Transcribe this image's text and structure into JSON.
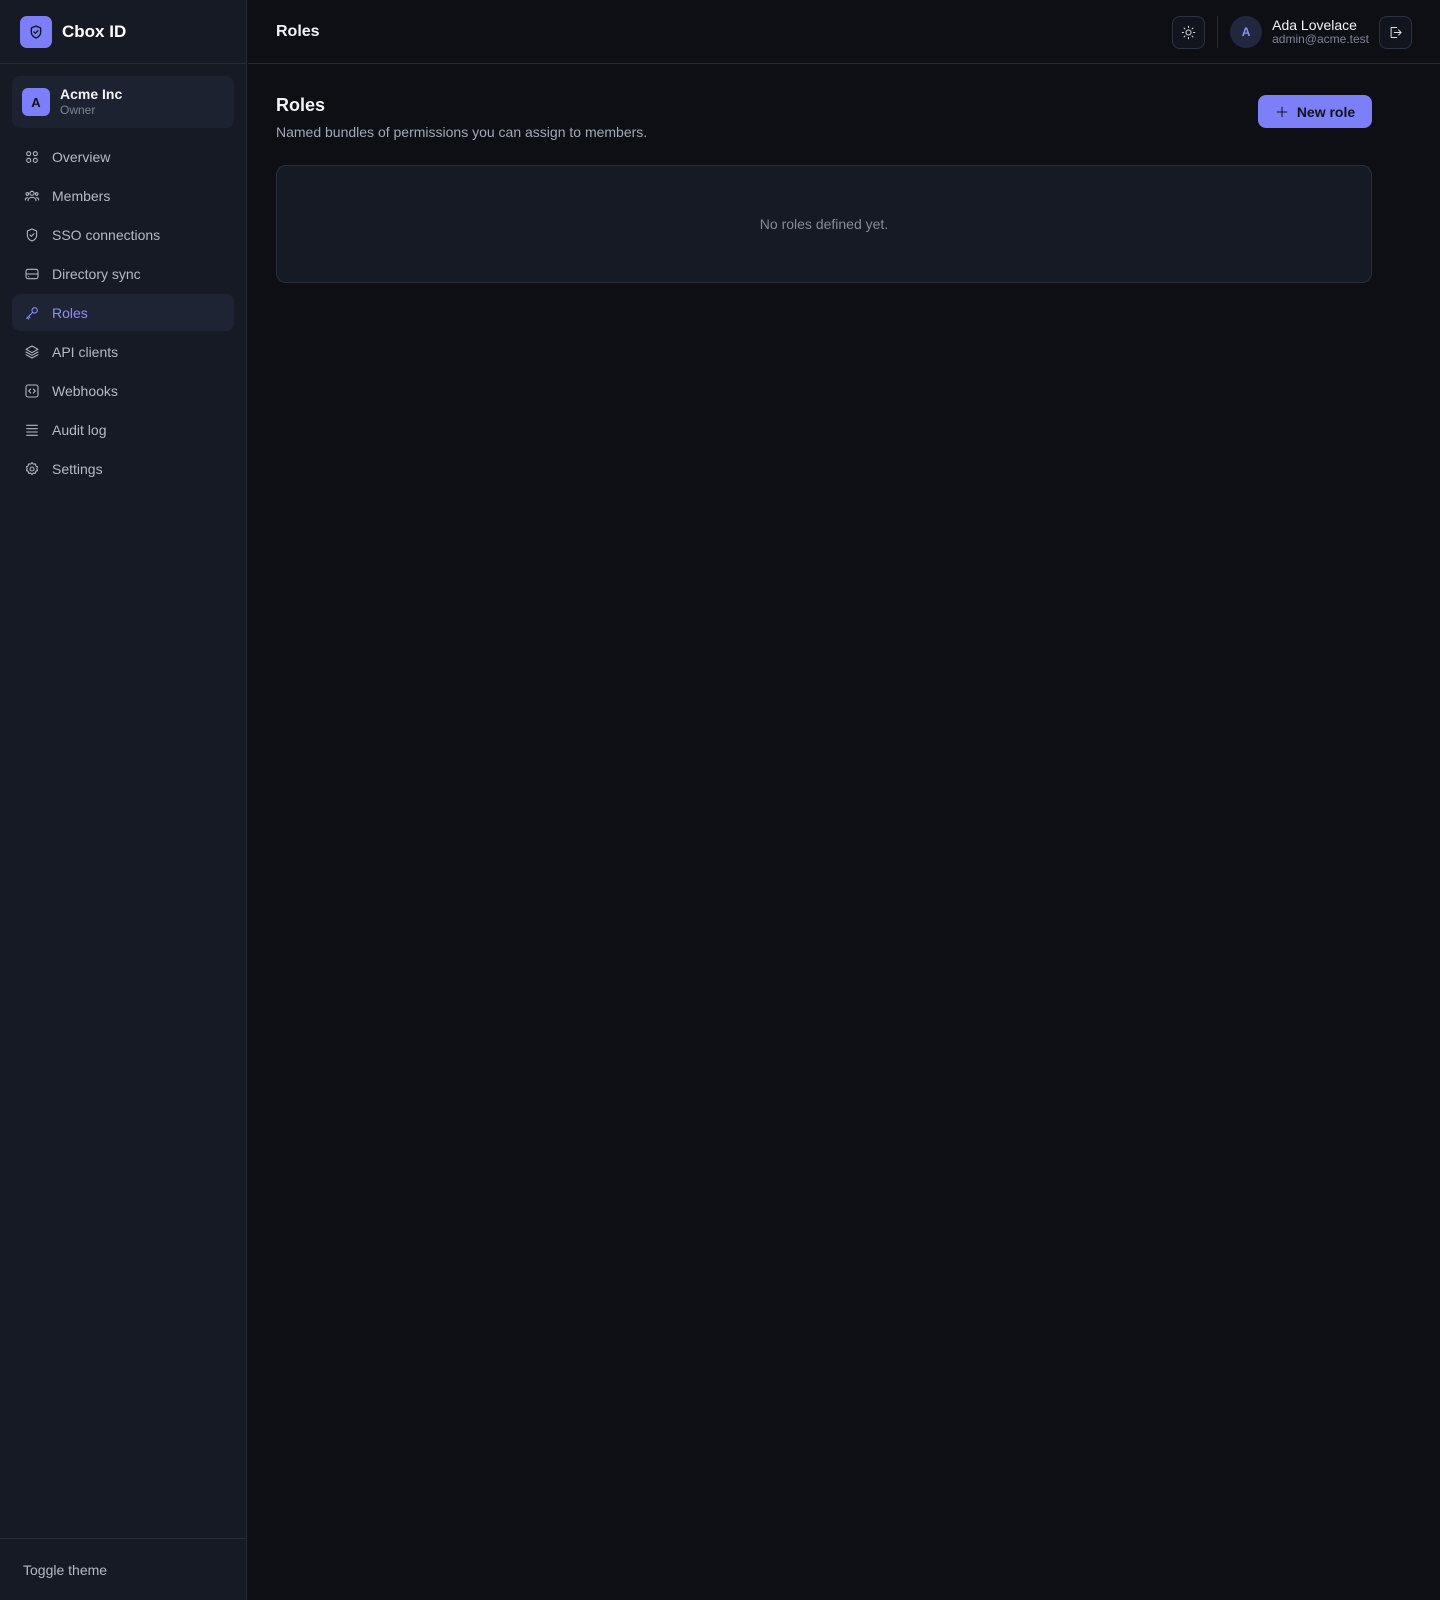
{
  "brand": {
    "name": "Cbox ID",
    "logo_icon": "shield-check-icon",
    "accent": "#7c7ff7"
  },
  "org": {
    "initial": "A",
    "name": "Acme Inc",
    "role": "Owner"
  },
  "sidebar": {
    "items": [
      {
        "label": "Overview",
        "icon": "grid-icon",
        "active": false
      },
      {
        "label": "Members",
        "icon": "users-icon",
        "active": false
      },
      {
        "label": "SSO connections",
        "icon": "shield-check-icon",
        "active": false
      },
      {
        "label": "Directory sync",
        "icon": "database-icon",
        "active": false
      },
      {
        "label": "Roles",
        "icon": "key-icon",
        "active": true
      },
      {
        "label": "API clients",
        "icon": "layers-icon",
        "active": false
      },
      {
        "label": "Webhooks",
        "icon": "code-icon",
        "active": false
      },
      {
        "label": "Audit log",
        "icon": "list-icon",
        "active": false
      },
      {
        "label": "Settings",
        "icon": "gear-icon",
        "active": false
      }
    ],
    "footer_label": "Toggle theme"
  },
  "header": {
    "title": "Roles",
    "theme_icon": "sun-icon",
    "user": {
      "initial": "A",
      "name": "Ada Lovelace",
      "email": "admin@acme.test"
    },
    "logout_icon": "logout-icon"
  },
  "main": {
    "title": "Roles",
    "subtitle": "Named bundles of permissions you can assign to members.",
    "new_button_label": "New role",
    "empty_text": "No roles defined yet."
  }
}
